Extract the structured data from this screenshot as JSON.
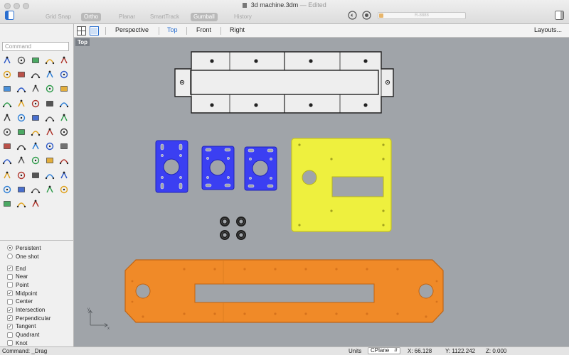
{
  "window": {
    "title": "3d machine.3dm",
    "edited_label": "— Edited"
  },
  "toolbar": {
    "osnap_toggles": [
      {
        "label": "Grid Snap",
        "on": false
      },
      {
        "label": "Ortho",
        "on": true
      },
      {
        "label": "Planar",
        "on": false
      },
      {
        "label": "SmartTrack",
        "on": false
      },
      {
        "label": "Gumball",
        "on": true
      },
      {
        "label": "History",
        "on": false
      }
    ],
    "progress_fraction": 0.05,
    "progress_label": "R-8888"
  },
  "viewbar": {
    "tabs": [
      {
        "label": "Perspective",
        "active": false
      },
      {
        "label": "Top",
        "active": true
      },
      {
        "label": "Front",
        "active": false
      },
      {
        "label": "Right",
        "active": false
      }
    ],
    "layouts_label": "Layouts..."
  },
  "command": {
    "placeholder": "Command"
  },
  "osnap": {
    "persistent_label": "Persistent",
    "oneshot_label": "One shot",
    "mode": "persistent",
    "items": [
      {
        "label": "End",
        "checked": true
      },
      {
        "label": "Near",
        "checked": false
      },
      {
        "label": "Point",
        "checked": false
      },
      {
        "label": "Midpoint",
        "checked": true
      },
      {
        "label": "Center",
        "checked": false
      },
      {
        "label": "Intersection",
        "checked": true
      },
      {
        "label": "Perpendicular",
        "checked": true
      },
      {
        "label": "Tangent",
        "checked": true
      },
      {
        "label": "Quadrant",
        "checked": false
      },
      {
        "label": "Knot",
        "checked": false
      }
    ]
  },
  "viewport": {
    "label": "Top",
    "colors": {
      "background": "#a0a4a9",
      "selected_blue": "#3b3ff2",
      "selected_yellow": "#f2f23a",
      "selected_orange": "#f08a28",
      "plate_white": "#eeeeee"
    }
  },
  "statusbar": {
    "command_text": "Command: _Drag",
    "units_label": "Units",
    "cplane_label": "CPlane",
    "x_readout": "X: 66.128",
    "y_readout": "Y: 1122.242",
    "z_readout": "Z: 0.000"
  }
}
